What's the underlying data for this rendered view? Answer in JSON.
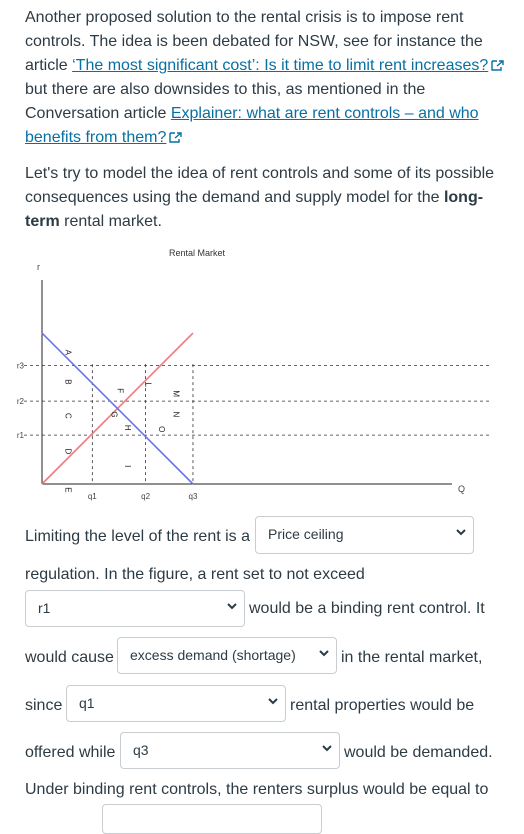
{
  "intro": {
    "p1_a": "Another proposed solution to the rental crisis is to impose rent controls. The idea is been debated for NSW, see for instance the article ",
    "link1": "‘The most significant cost’: Is it time to limit rent increases?",
    "p1_b": " but there are also downsides to this, as mentioned in the Conversation article ",
    "link2": "Explainer: what are rent controls – and who benefits from them?",
    "p2_a": "Let's try to model the idea of rent controls and some of its possible consequences using the demand and supply model for the ",
    "p2_bold": "long-term",
    "p2_b": " rental market."
  },
  "chart_data": {
    "type": "line",
    "title": "Rental Market",
    "xlabel": "Q",
    "ylabel": "r",
    "y_ticks": [
      "r3",
      "r2",
      "r1"
    ],
    "x_ticks": [
      "q1",
      "q2",
      "q3"
    ],
    "series": [
      {
        "color": "#f07a7a",
        "points": [
          [
            0,
            0
          ],
          [
            5.1,
            5.1
          ]
        ]
      },
      {
        "color": "#6d74e8",
        "points": [
          [
            0,
            5.1
          ],
          [
            5.1,
            0
          ]
        ]
      }
    ],
    "area_labels": [
      "A",
      "B",
      "C",
      "D",
      "E",
      "F",
      "G",
      "H",
      "I",
      "L",
      "M",
      "N",
      "O"
    ],
    "colors": {
      "supply": "#f07a7a",
      "demand": "#6d74e8"
    }
  },
  "question": {
    "s1": "Limiting the level of the rent is a",
    "dd1": "Price ceiling",
    "s2": "regulation. In the figure, a rent set to not exceed",
    "dd2": "r1",
    "s3": "would be a binding rent control. It",
    "s4": "would cause",
    "dd3": "excess demand (shortage)",
    "s5": "in the rental market,",
    "s6": "since",
    "dd4": "q1",
    "s7": "rental properties would be",
    "s8": "offered while",
    "dd5": "q3",
    "s9": "would be demanded.",
    "s10": "Under binding rent controls, the renters surplus would be equal to"
  }
}
